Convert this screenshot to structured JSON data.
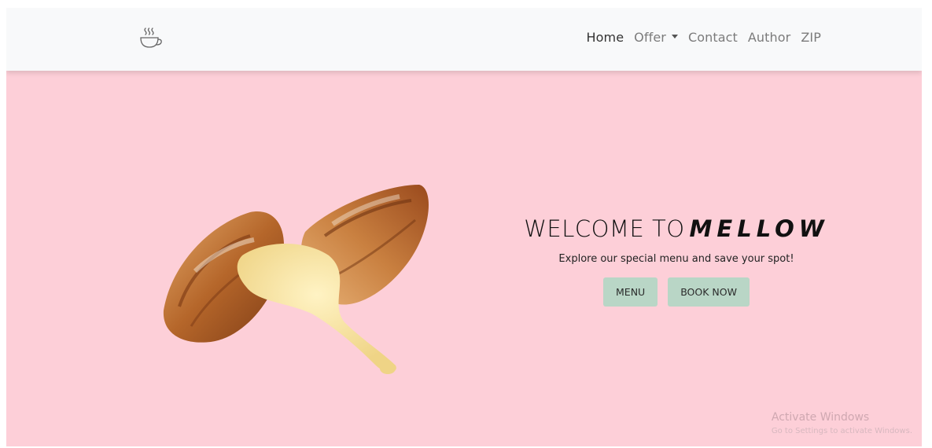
{
  "nav": {
    "logo_icon": "coffee-cup-icon",
    "links": [
      {
        "label": "Home",
        "active": true
      },
      {
        "label": "Offer",
        "dropdown": true
      },
      {
        "label": "Contact"
      },
      {
        "label": "Author"
      },
      {
        "label": "ZIP"
      }
    ]
  },
  "hero": {
    "title_prefix": "WELCOME TO",
    "brand": "MELLOW",
    "subtitle": "Explore our special menu and save your spot!",
    "buttons": {
      "menu": "MENU",
      "book": "BOOK NOW"
    },
    "image_icon": "croissant-image",
    "background_color": "#fdcfd8",
    "button_color": "#b9d6c6"
  },
  "watermark": {
    "title": "Activate Windows",
    "subtitle": "Go to Settings to activate Windows."
  }
}
